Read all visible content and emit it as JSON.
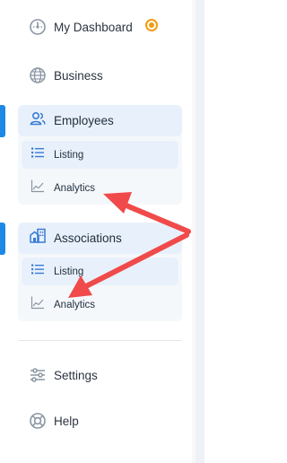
{
  "nav": {
    "dashboard": {
      "label": "My Dashboard",
      "icon": "dashboard-icon",
      "notification": true
    },
    "business": {
      "label": "Business",
      "icon": "globe-icon"
    },
    "employees": {
      "label": "Employees",
      "icon": "users-icon",
      "items": [
        {
          "label": "Listing",
          "icon": "list-icon",
          "active": true
        },
        {
          "label": "Analytics",
          "icon": "chart-line-icon",
          "active": false
        }
      ]
    },
    "associations": {
      "label": "Associations",
      "icon": "building-icon",
      "items": [
        {
          "label": "Listing",
          "icon": "list-icon",
          "active": true
        },
        {
          "label": "Analytics",
          "icon": "chart-line-icon",
          "active": false
        }
      ]
    },
    "settings": {
      "label": "Settings",
      "icon": "sliders-icon"
    },
    "help": {
      "label": "Help",
      "icon": "lifebuoy-icon"
    }
  },
  "colors": {
    "accent": "#1e88e5",
    "group_bg": "#f5f8fb",
    "active_bg": "#e8f1fb",
    "icon": "#3a7bd5",
    "notification": "#f39c12",
    "annotation_arrow": "#f04a4a"
  }
}
